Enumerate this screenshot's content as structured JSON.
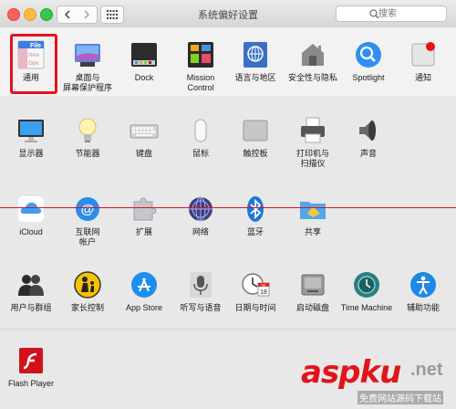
{
  "window": {
    "title": "系统偏好设置",
    "search_placeholder": "搜索"
  },
  "rows": {
    "r1": [
      {
        "label": "通用",
        "icon": "general-icon"
      },
      {
        "label": "桌面与\n屏幕保护程序",
        "icon": "desktop-icon"
      },
      {
        "label": "Dock",
        "icon": "dock-icon"
      },
      {
        "label": "Mission\nControl",
        "icon": "mission-control-icon"
      },
      {
        "label": "语言与地区",
        "icon": "language-icon"
      },
      {
        "label": "安全性与隐私",
        "icon": "security-icon"
      },
      {
        "label": "Spotlight",
        "icon": "spotlight-icon"
      },
      {
        "label": "通知",
        "icon": "notifications-icon"
      }
    ],
    "r2": [
      {
        "label": "显示器",
        "icon": "display-icon"
      },
      {
        "label": "节能器",
        "icon": "energy-icon"
      },
      {
        "label": "键盘",
        "icon": "keyboard-icon"
      },
      {
        "label": "鼠标",
        "icon": "mouse-icon"
      },
      {
        "label": "触控板",
        "icon": "trackpad-icon"
      },
      {
        "label": "打印机与\n扫描仪",
        "icon": "printer-icon"
      },
      {
        "label": "声音",
        "icon": "sound-icon"
      }
    ],
    "r3": [
      {
        "label": "iCloud",
        "icon": "icloud-icon"
      },
      {
        "label": "互联网\n帐户",
        "icon": "internet-accounts-icon"
      },
      {
        "label": "扩展",
        "icon": "extensions-icon"
      },
      {
        "label": "网络",
        "icon": "network-icon"
      },
      {
        "label": "蓝牙",
        "icon": "bluetooth-icon"
      },
      {
        "label": "共享",
        "icon": "sharing-icon"
      }
    ],
    "r4": [
      {
        "label": "用户与群组",
        "icon": "users-icon"
      },
      {
        "label": "家长控制",
        "icon": "parental-icon"
      },
      {
        "label": "App Store",
        "icon": "appstore-icon"
      },
      {
        "label": "听写与语音",
        "icon": "dictation-icon"
      },
      {
        "label": "日期与时间",
        "icon": "datetime-icon"
      },
      {
        "label": "启动磁盘",
        "icon": "startup-disk-icon"
      },
      {
        "label": "Time Machine",
        "icon": "timemachine-icon"
      },
      {
        "label": "辅助功能",
        "icon": "accessibility-icon"
      }
    ],
    "r5": [
      {
        "label": "Flash Player",
        "icon": "flash-icon"
      }
    ]
  },
  "general_icon_text": {
    "a": "File",
    "b": "New",
    "c": "Ope"
  },
  "datetime_icon_text": {
    "month": "JUL",
    "day": "18"
  },
  "watermark": {
    "brand": "aspku",
    "net": ".net",
    "sub": "免费网站源码下载站"
  },
  "colors": {
    "highlight": "#e8121a",
    "accent": "#1b8ef4"
  }
}
